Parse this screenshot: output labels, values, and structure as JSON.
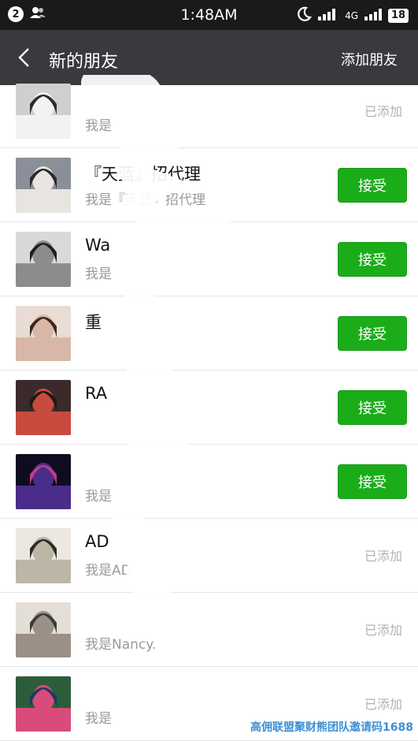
{
  "status_bar": {
    "notification_count": "2",
    "time": "1:48AM",
    "network": "4G",
    "battery": "18"
  },
  "header": {
    "back_icon": "chevron-left-icon",
    "title": "新的朋友",
    "action_label": "添加朋友"
  },
  "requests": [
    {
      "name": "",
      "message": "我是",
      "state": "已添加",
      "avatar_colors": [
        "#cfcfcf",
        "#f2f2f2",
        "#2b2b2b"
      ]
    },
    {
      "name": "『天蓝』招代理",
      "message": "我是『天蓝』招代理",
      "state": "接受",
      "avatar_colors": [
        "#8a8f99",
        "#e8e5e0",
        "#2a2a2a"
      ]
    },
    {
      "name": "Wa",
      "message": "我是",
      "state": "接受",
      "avatar_colors": [
        "#d9d9d9",
        "#8c8c8c",
        "#1e1e1e"
      ]
    },
    {
      "name": "重",
      "message": "",
      "state": "接受",
      "avatar_colors": [
        "#e9dcd4",
        "#d9b7a8",
        "#3a2620"
      ]
    },
    {
      "name": "RA",
      "message": "",
      "state": "接受",
      "avatar_colors": [
        "#3b2a2a",
        "#c94a3f",
        "#1a1a1a"
      ]
    },
    {
      "name": "",
      "message": "我是",
      "state": "接受",
      "avatar_colors": [
        "#0d0d1f",
        "#4b2c8a",
        "#c23b8a"
      ]
    },
    {
      "name": "AD",
      "message": "我是AD",
      "state": "已添加",
      "avatar_colors": [
        "#ece8df",
        "#bdb6a6",
        "#2b2b2b"
      ]
    },
    {
      "name": "",
      "message": "我是Nancy.",
      "state": "已添加",
      "avatar_colors": [
        "#e4dfd6",
        "#9b8f86",
        "#3a3a3a"
      ]
    },
    {
      "name": "",
      "message": "我是",
      "state": "已添加",
      "avatar_colors": [
        "#2c5d3a",
        "#d94b7a",
        "#1b3a5e"
      ]
    }
  ],
  "accept_color": "#1aad19",
  "title_bar_color": "#393a3e",
  "watermark": "高佣联盟聚财熊团队邀请码1688"
}
